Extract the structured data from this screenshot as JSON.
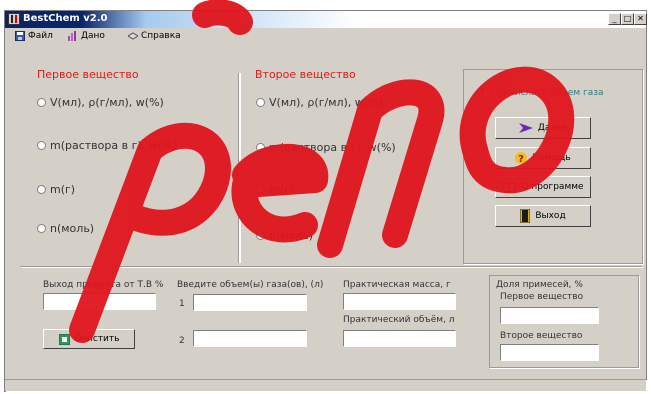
{
  "window": {
    "title": "BestChem v2.0",
    "controls": [
      "_",
      "□",
      "✕"
    ]
  },
  "menu": [
    {
      "label": "Файл",
      "icon": "floppy-icon"
    },
    {
      "label": "Дано",
      "icon": "chart-icon"
    },
    {
      "label": "Справка",
      "icon": "book-icon"
    }
  ],
  "substance1": {
    "title": "Первое вещество",
    "options": [
      "V(мл), ρ(г/мл), w(%)",
      "m(раствора в г), w(%)",
      "m(г)",
      "n(моль)"
    ]
  },
  "substance2": {
    "title": "Второе вещество",
    "options": [
      "V(мл), ρ(г/мл), w(%)",
      "m(раствора в г), w(%)",
      "m(г)",
      "n(моль)"
    ]
  },
  "right_panel": {
    "gas_checkbox": "Вычислить объем газа",
    "next_button": "Далее",
    "help_button": "Помощь",
    "about_button": "О программе",
    "exit_button": "Выход"
  },
  "bottom": {
    "yield_label": "Выход продукта от Т.В %",
    "yield_value": "",
    "clear_button": "Очистить",
    "gas_volume_label": "Введите объем(ы) газа(ов), (л)",
    "gas_row_1": "1",
    "gas_row_2": "2",
    "gas_value_1": "",
    "gas_value_2": "",
    "practical_mass_label": "Практическая масса, г",
    "practical_mass_value": "",
    "practical_volume_label": "Практический объём, л",
    "practical_volume_value": "",
    "impurity_label": "Доля примесей, %",
    "impurity_first_label": "Первое вещество",
    "impurity_first_value": "",
    "impurity_second_label": "Второе вещество",
    "impurity_second_value": ""
  },
  "watermark": {
    "color": "#e0141c"
  }
}
